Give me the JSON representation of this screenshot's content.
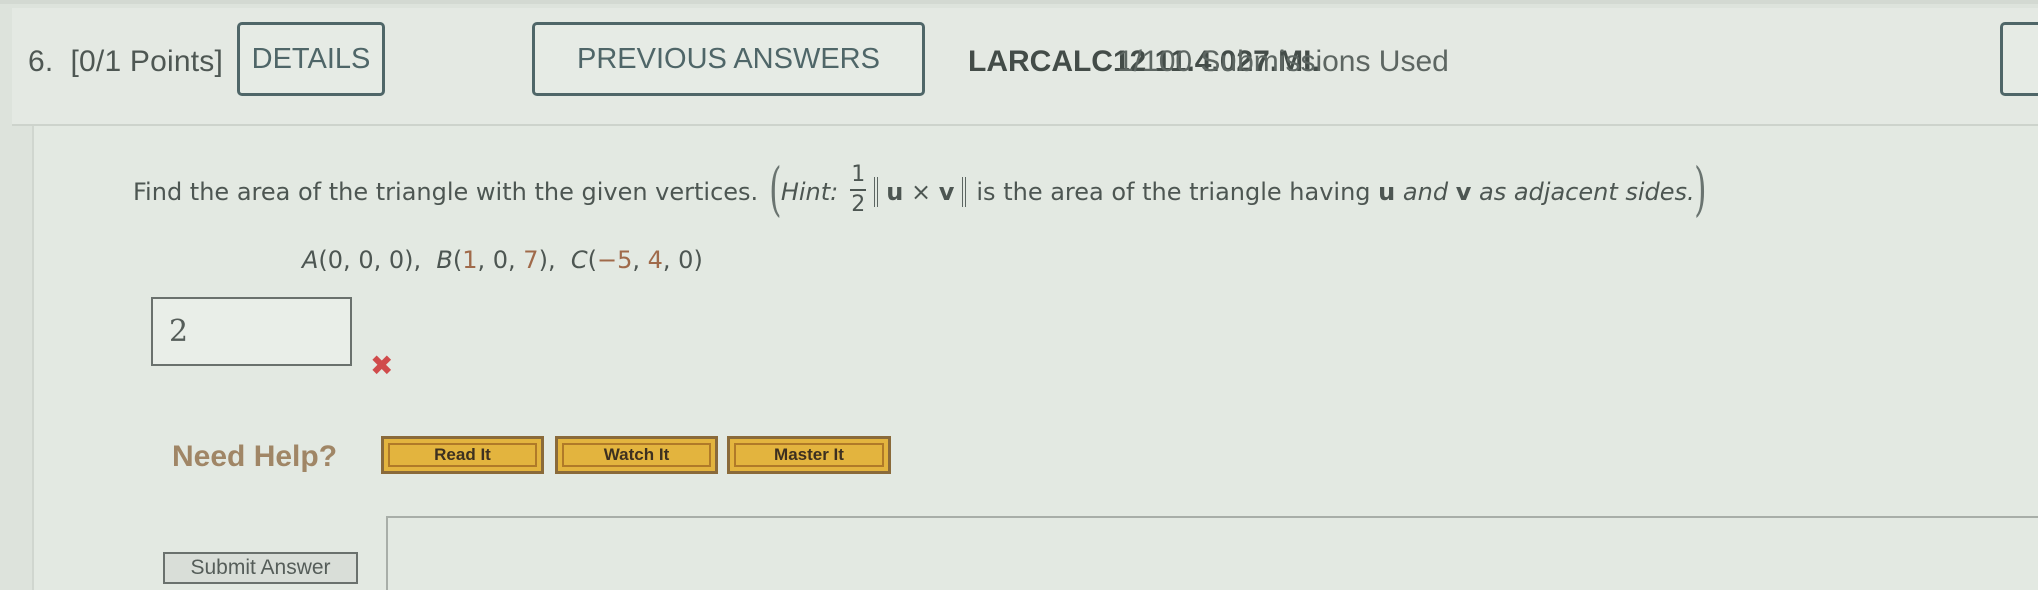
{
  "header": {
    "question_number": "6.",
    "points": "[0/1 Points]",
    "details_label": "DETAILS",
    "previous_answers_label": "PREVIOUS ANSWERS",
    "question_id": "LARCALC12 11.4.027.MI.",
    "submissions": "1/100 Submissions Used"
  },
  "question": {
    "prompt": "Find the area of the triangle with the given vertices.",
    "hint_label": "Hint:",
    "frac_num": "1",
    "frac_den": "2",
    "u": "u",
    "times": "×",
    "v": "v",
    "hint_text_1": "is the area of the triangle having",
    "hint_u": "u",
    "hint_and": "and",
    "hint_v": "v",
    "hint_text_2": "as adjacent sides.",
    "vertices": {
      "A_label": "A",
      "A": "(0, 0, 0),",
      "B_label": "B",
      "B_open": "(",
      "B_x": "1",
      "B_mid": ", 0, ",
      "B_z": "7",
      "B_close": "),",
      "C_label": "C",
      "C_open": "(",
      "C_x": "−5",
      "C_sep": ", ",
      "C_y": "4",
      "C_close": ", 0)"
    }
  },
  "answer": {
    "value": "2",
    "status": "incorrect",
    "status_icon": "✖",
    "status_color": "#d04b4b"
  },
  "help": {
    "label": "Need Help?",
    "read_it": "Read It",
    "watch_it": "Watch It",
    "master_it": "Master It"
  },
  "submit": {
    "label": "Submit Answer"
  }
}
